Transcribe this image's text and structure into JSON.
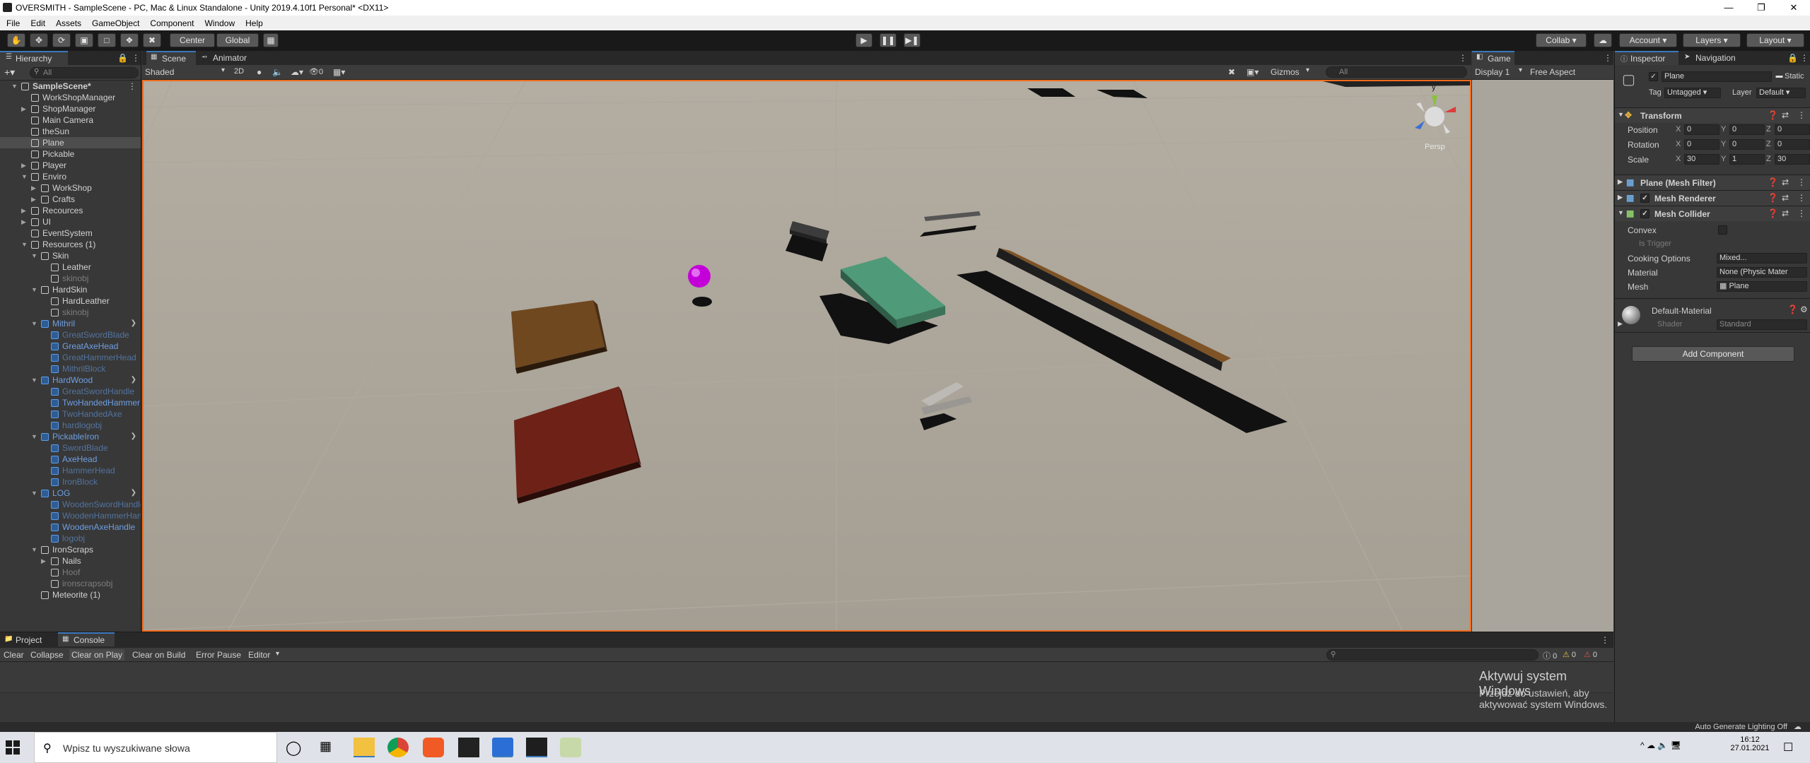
{
  "window": {
    "title": "OVERSMITH - SampleScene - PC, Mac & Linux Standalone - Unity 2019.4.10f1 Personal* <DX11>"
  },
  "menu": [
    "File",
    "Edit",
    "Assets",
    "GameObject",
    "Component",
    "Window",
    "Help"
  ],
  "toolbar": {
    "pivot": "Center",
    "space": "Global",
    "collab": "Collab",
    "account": "Account",
    "layers": "Layers",
    "layout": "Layout"
  },
  "hierarchy": {
    "tab": "Hierarchy",
    "search": "All",
    "items": [
      {
        "label": "SampleScene*",
        "depth": 0,
        "arrow": "down",
        "kind": "scene",
        "bold": true
      },
      {
        "label": "WorkShopManager",
        "depth": 1,
        "arrow": "",
        "kind": "go"
      },
      {
        "label": "ShopManager",
        "depth": 1,
        "arrow": "right",
        "kind": "go"
      },
      {
        "label": "Main Camera",
        "depth": 1,
        "arrow": "",
        "kind": "go"
      },
      {
        "label": "theSun",
        "depth": 1,
        "arrow": "",
        "kind": "go"
      },
      {
        "label": "Plane",
        "depth": 1,
        "arrow": "",
        "kind": "go",
        "selected": true
      },
      {
        "label": "Pickable",
        "depth": 1,
        "arrow": "",
        "kind": "go"
      },
      {
        "label": "Player",
        "depth": 1,
        "arrow": "right",
        "kind": "go"
      },
      {
        "label": "Enviro",
        "depth": 1,
        "arrow": "down",
        "kind": "go"
      },
      {
        "label": "WorkShop",
        "depth": 2,
        "arrow": "right",
        "kind": "go"
      },
      {
        "label": "Crafts",
        "depth": 2,
        "arrow": "right",
        "kind": "go"
      },
      {
        "label": "Recources",
        "depth": 1,
        "arrow": "right",
        "kind": "go"
      },
      {
        "label": "UI",
        "depth": 1,
        "arrow": "right",
        "kind": "go"
      },
      {
        "label": "EventSystem",
        "depth": 1,
        "arrow": "",
        "kind": "go"
      },
      {
        "label": "Resources (1)",
        "depth": 1,
        "arrow": "down",
        "kind": "go"
      },
      {
        "label": "Skin",
        "depth": 2,
        "arrow": "down",
        "kind": "go"
      },
      {
        "label": "Leather",
        "depth": 3,
        "arrow": "",
        "kind": "go"
      },
      {
        "label": "skinobj",
        "depth": 3,
        "arrow": "",
        "kind": "go",
        "dis": true
      },
      {
        "label": "HardSkin",
        "depth": 2,
        "arrow": "down",
        "kind": "go"
      },
      {
        "label": "HardLeather",
        "depth": 3,
        "arrow": "",
        "kind": "go"
      },
      {
        "label": "skinobj",
        "depth": 3,
        "arrow": "",
        "kind": "go",
        "dis": true
      },
      {
        "label": "Mithril",
        "depth": 2,
        "arrow": "down",
        "kind": "prefab",
        "chev": true
      },
      {
        "label": "GreatSwordBlade",
        "depth": 3,
        "arrow": "",
        "kind": "prefab",
        "dis": true
      },
      {
        "label": "GreatAxeHead",
        "depth": 3,
        "arrow": "",
        "kind": "prefab"
      },
      {
        "label": "GreatHammerHead",
        "depth": 3,
        "arrow": "",
        "kind": "prefab",
        "dis": true
      },
      {
        "label": "MithrilBlock",
        "depth": 3,
        "arrow": "",
        "kind": "prefab",
        "dis": true
      },
      {
        "label": "HardWood",
        "depth": 2,
        "arrow": "down",
        "kind": "prefab",
        "chev": true
      },
      {
        "label": "GreatSwordHandle",
        "depth": 3,
        "arrow": "",
        "kind": "prefab",
        "dis": true
      },
      {
        "label": "TwoHandedHammer",
        "depth": 3,
        "arrow": "",
        "kind": "prefab"
      },
      {
        "label": "TwoHandedAxe",
        "depth": 3,
        "arrow": "",
        "kind": "prefab",
        "dis": true
      },
      {
        "label": "hardlogobj",
        "depth": 3,
        "arrow": "",
        "kind": "prefab",
        "dis": true
      },
      {
        "label": "PickableIron",
        "depth": 2,
        "arrow": "down",
        "kind": "prefab",
        "chev": true
      },
      {
        "label": "SwordBlade",
        "depth": 3,
        "arrow": "",
        "kind": "prefab",
        "dis": true
      },
      {
        "label": "AxeHead",
        "depth": 3,
        "arrow": "",
        "kind": "prefab"
      },
      {
        "label": "HammerHead",
        "depth": 3,
        "arrow": "",
        "kind": "prefab",
        "dis": true
      },
      {
        "label": "IronBlock",
        "depth": 3,
        "arrow": "",
        "kind": "prefab",
        "dis": true
      },
      {
        "label": "LOG",
        "depth": 2,
        "arrow": "down",
        "kind": "prefab",
        "chev": true
      },
      {
        "label": "WoodenSwordHandle",
        "depth": 3,
        "arrow": "",
        "kind": "prefab",
        "dis": true
      },
      {
        "label": "WoodenHammerHandle",
        "depth": 3,
        "arrow": "",
        "kind": "prefab",
        "dis": true
      },
      {
        "label": "WoodenAxeHandle",
        "depth": 3,
        "arrow": "",
        "kind": "prefab"
      },
      {
        "label": "logobj",
        "depth": 3,
        "arrow": "",
        "kind": "prefab",
        "dis": true
      },
      {
        "label": "IronScraps",
        "depth": 2,
        "arrow": "down",
        "kind": "go"
      },
      {
        "label": "Nails",
        "depth": 3,
        "arrow": "right",
        "kind": "go"
      },
      {
        "label": "Hoof",
        "depth": 3,
        "arrow": "",
        "kind": "go",
        "dis": true
      },
      {
        "label": "ironscrapsobj",
        "depth": 3,
        "arrow": "",
        "kind": "go",
        "dis": true
      },
      {
        "label": "Meteorite (1)",
        "depth": 2,
        "arrow": "",
        "kind": "go"
      }
    ]
  },
  "scene": {
    "tab_scene": "Scene",
    "tab_animator": "Animator",
    "shading": "Shaded",
    "mode2d": "2D",
    "hidden": "0",
    "gizmos": "Gizmos",
    "search": "All",
    "persp": "Persp",
    "axis_y": "y"
  },
  "game": {
    "tab": "Game",
    "display": "Display 1",
    "aspect": "Free Aspect"
  },
  "inspector": {
    "tab": "Inspector",
    "tab2": "Navigation",
    "name": "Plane",
    "static": "Static",
    "tag_label": "Tag",
    "tag": "Untagged",
    "layer_label": "Layer",
    "layer": "Default",
    "transform": {
      "title": "Transform",
      "rows": [
        {
          "label": "Position",
          "x": "0",
          "y": "0",
          "z": "0"
        },
        {
          "label": "Rotation",
          "x": "0",
          "y": "0",
          "z": "0"
        },
        {
          "label": "Scale",
          "x": "30",
          "y": "1",
          "z": "30"
        }
      ]
    },
    "mesh_filter": "Plane (Mesh Filter)",
    "mesh_renderer": "Mesh Renderer",
    "mesh_collider": "Mesh Collider",
    "collider": {
      "convex": "Convex",
      "is_trigger": "Is Trigger",
      "cooking": "Cooking Options",
      "cooking_val": "Mixed...",
      "material": "Material",
      "material_val": "None (Physic Mater",
      "mesh": "Mesh",
      "mesh_val": "Plane"
    },
    "material": {
      "name": "Default-Material",
      "shader_label": "Shader",
      "shader": "Standard"
    },
    "add_component": "Add Component"
  },
  "console": {
    "tab_project": "Project",
    "tab_console": "Console",
    "buttons": [
      "Clear",
      "Collapse",
      "Clear on Play",
      "Clear on Build",
      "Error Pause",
      "Editor"
    ],
    "count_log": "0",
    "count_warn": "0",
    "count_err": "0"
  },
  "watermark": {
    "line1": "Aktywuj system Windows",
    "line2": "Przejdź do ustawień, aby aktywować system Windows."
  },
  "status": {
    "right": "Auto Generate Lighting Off"
  },
  "taskbar": {
    "search": "Wpisz tu wyszukiwane słowa",
    "time": "16:12",
    "date": "27.01.2021"
  },
  "colors": {
    "accent": "#3a79bb",
    "selection_border": "#f26b1c",
    "ground": "#a59f94",
    "sphere": "#c400d8",
    "green_box": "#4f9a78",
    "red_box": "#6e2217",
    "brown_box": "#6f4820"
  }
}
